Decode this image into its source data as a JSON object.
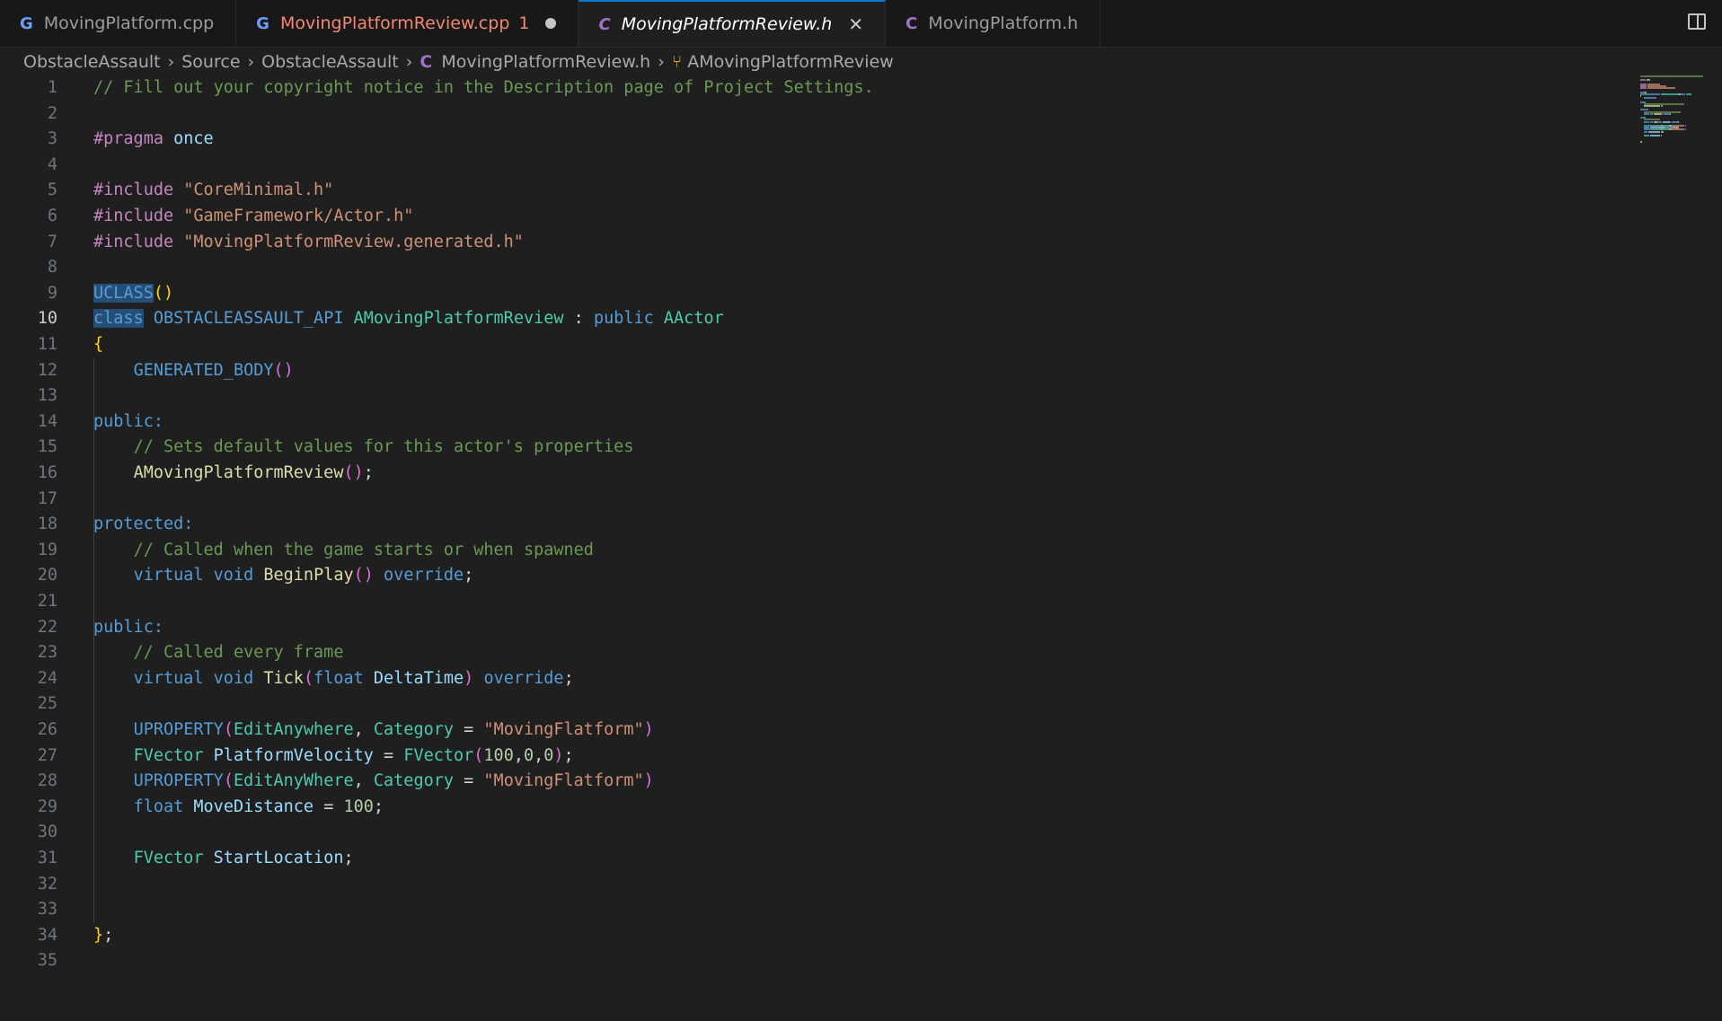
{
  "tabs": [
    {
      "icon": "G",
      "label": "MovingPlatform.cpp",
      "kind": "cpp"
    },
    {
      "icon": "G",
      "label": "MovingPlatformReview.cpp",
      "count": "1",
      "kind": "cpp",
      "modified": true
    },
    {
      "icon": "C",
      "label": "MovingPlatformReview.h",
      "kind": "h",
      "active": true
    },
    {
      "icon": "C",
      "label": "MovingPlatform.h",
      "kind": "h"
    }
  ],
  "breadcrumb": {
    "items": [
      "ObstacleAssault",
      "Source",
      "ObstacleAssault"
    ],
    "file_icon": "C",
    "file": "MovingPlatformReview.h",
    "symbol": "AMovingPlatformReview"
  },
  "editor": {
    "current_line": 10,
    "lines": [
      {
        "n": "1",
        "tokens": [
          [
            "c-comment",
            "// Fill out your copyright notice in the Description page of Project Settings."
          ]
        ]
      },
      {
        "n": "2",
        "tokens": []
      },
      {
        "n": "3",
        "tokens": [
          [
            "c-pp",
            "#pragma"
          ],
          [
            "c-plain",
            " "
          ],
          [
            "c-var",
            "once"
          ]
        ]
      },
      {
        "n": "4",
        "tokens": []
      },
      {
        "n": "5",
        "tokens": [
          [
            "c-pp",
            "#include"
          ],
          [
            "c-plain",
            " "
          ],
          [
            "c-str",
            "\"CoreMinimal.h\""
          ]
        ]
      },
      {
        "n": "6",
        "tokens": [
          [
            "c-pp",
            "#include"
          ],
          [
            "c-plain",
            " "
          ],
          [
            "c-str",
            "\"GameFramework/Actor.h\""
          ]
        ]
      },
      {
        "n": "7",
        "tokens": [
          [
            "c-pp",
            "#include"
          ],
          [
            "c-plain",
            " "
          ],
          [
            "c-str",
            "\"MovingPlatformReview.generated.h\""
          ]
        ]
      },
      {
        "n": "8",
        "tokens": []
      },
      {
        "n": "9",
        "tokens": [
          [
            "c-macro c-hl",
            "UCLASS"
          ],
          [
            "c-brace",
            "()"
          ]
        ]
      },
      {
        "n": "10",
        "tokens": [
          [
            "c-kw c-hl",
            "class"
          ],
          [
            "c-plain",
            " "
          ],
          [
            "c-macro",
            "OBSTACLEASSAULT_API"
          ],
          [
            "c-plain",
            " "
          ],
          [
            "c-type",
            "AMovingPlatformReview"
          ],
          [
            "c-plain",
            " : "
          ],
          [
            "c-kw",
            "public"
          ],
          [
            "c-plain",
            " "
          ],
          [
            "c-type",
            "AActor"
          ]
        ]
      },
      {
        "n": "11",
        "tokens": [
          [
            "c-brace",
            "{"
          ]
        ]
      },
      {
        "n": "12",
        "tokens": [
          [
            "c-plain",
            "    "
          ],
          [
            "c-macro",
            "GENERATED_BODY"
          ],
          [
            "c-paren",
            "()"
          ]
        ]
      },
      {
        "n": "13",
        "tokens": []
      },
      {
        "n": "14",
        "tokens": [
          [
            "c-kw",
            "public:"
          ]
        ]
      },
      {
        "n": "15",
        "tokens": [
          [
            "c-plain",
            "    "
          ],
          [
            "c-comment",
            "// Sets default values for this actor's properties"
          ]
        ]
      },
      {
        "n": "16",
        "tokens": [
          [
            "c-plain",
            "    "
          ],
          [
            "c-func",
            "AMovingPlatformReview"
          ],
          [
            "c-paren",
            "()"
          ],
          [
            "c-plain",
            ";"
          ]
        ]
      },
      {
        "n": "17",
        "tokens": []
      },
      {
        "n": "18",
        "tokens": [
          [
            "c-kw",
            "protected:"
          ]
        ]
      },
      {
        "n": "19",
        "tokens": [
          [
            "c-plain",
            "    "
          ],
          [
            "c-comment",
            "// Called when the game starts or when spawned"
          ]
        ]
      },
      {
        "n": "20",
        "tokens": [
          [
            "c-plain",
            "    "
          ],
          [
            "c-kw",
            "virtual"
          ],
          [
            "c-plain",
            " "
          ],
          [
            "c-kw",
            "void"
          ],
          [
            "c-plain",
            " "
          ],
          [
            "c-func",
            "BeginPlay"
          ],
          [
            "c-paren",
            "()"
          ],
          [
            "c-plain",
            " "
          ],
          [
            "c-kw",
            "override"
          ],
          [
            "c-plain",
            ";"
          ]
        ]
      },
      {
        "n": "21",
        "tokens": []
      },
      {
        "n": "22",
        "tokens": [
          [
            "c-kw",
            "public:"
          ]
        ]
      },
      {
        "n": "23",
        "tokens": [
          [
            "c-plain",
            "    "
          ],
          [
            "c-comment",
            "// Called every frame"
          ]
        ]
      },
      {
        "n": "24",
        "tokens": [
          [
            "c-plain",
            "    "
          ],
          [
            "c-kw",
            "virtual"
          ],
          [
            "c-plain",
            " "
          ],
          [
            "c-kw",
            "void"
          ],
          [
            "c-plain",
            " "
          ],
          [
            "c-func",
            "Tick"
          ],
          [
            "c-paren",
            "("
          ],
          [
            "c-kw",
            "float"
          ],
          [
            "c-plain",
            " "
          ],
          [
            "c-var",
            "DeltaTime"
          ],
          [
            "c-paren",
            ")"
          ],
          [
            "c-plain",
            " "
          ],
          [
            "c-kw",
            "override"
          ],
          [
            "c-plain",
            ";"
          ]
        ]
      },
      {
        "n": "25",
        "tokens": []
      },
      {
        "n": "26",
        "tokens": [
          [
            "c-plain",
            "    "
          ],
          [
            "c-macro",
            "UPROPERTY"
          ],
          [
            "c-paren",
            "("
          ],
          [
            "c-type",
            "EditAnywhere"
          ],
          [
            "c-plain",
            ", "
          ],
          [
            "c-type",
            "Category"
          ],
          [
            "c-plain",
            " = "
          ],
          [
            "c-str",
            "\"MovingFlatform\""
          ],
          [
            "c-paren",
            ")"
          ]
        ]
      },
      {
        "n": "27",
        "tokens": [
          [
            "c-plain",
            "    "
          ],
          [
            "c-type",
            "FVector"
          ],
          [
            "c-plain",
            " "
          ],
          [
            "c-var",
            "PlatformVelocity"
          ],
          [
            "c-plain",
            " = "
          ],
          [
            "c-type",
            "FVector"
          ],
          [
            "c-paren",
            "("
          ],
          [
            "c-num",
            "100"
          ],
          [
            "c-plain",
            ","
          ],
          [
            "c-num",
            "0"
          ],
          [
            "c-plain",
            ","
          ],
          [
            "c-num",
            "0"
          ],
          [
            "c-paren",
            ")"
          ],
          [
            "c-plain",
            ";"
          ]
        ]
      },
      {
        "n": "28",
        "tokens": [
          [
            "c-plain",
            "    "
          ],
          [
            "c-macro",
            "UPROPERTY"
          ],
          [
            "c-paren",
            "("
          ],
          [
            "c-type",
            "EditAnyWhere"
          ],
          [
            "c-plain",
            ", "
          ],
          [
            "c-type",
            "Category"
          ],
          [
            "c-plain",
            " = "
          ],
          [
            "c-str",
            "\"MovingFlatform\""
          ],
          [
            "c-paren",
            ")"
          ]
        ]
      },
      {
        "n": "29",
        "tokens": [
          [
            "c-plain",
            "    "
          ],
          [
            "c-kw",
            "float"
          ],
          [
            "c-plain",
            " "
          ],
          [
            "c-var",
            "MoveDistance"
          ],
          [
            "c-plain",
            " = "
          ],
          [
            "c-num",
            "100"
          ],
          [
            "c-plain",
            ";"
          ]
        ]
      },
      {
        "n": "30",
        "tokens": []
      },
      {
        "n": "31",
        "tokens": [
          [
            "c-plain",
            "    "
          ],
          [
            "c-type",
            "FVector"
          ],
          [
            "c-plain",
            " "
          ],
          [
            "c-var",
            "StartLocation"
          ],
          [
            "c-plain",
            ";"
          ]
        ]
      },
      {
        "n": "32",
        "tokens": []
      },
      {
        "n": "33",
        "tokens": []
      },
      {
        "n": "34",
        "tokens": [
          [
            "c-brace",
            "}"
          ],
          [
            "c-plain",
            ";"
          ]
        ]
      },
      {
        "n": "35",
        "tokens": []
      }
    ]
  }
}
